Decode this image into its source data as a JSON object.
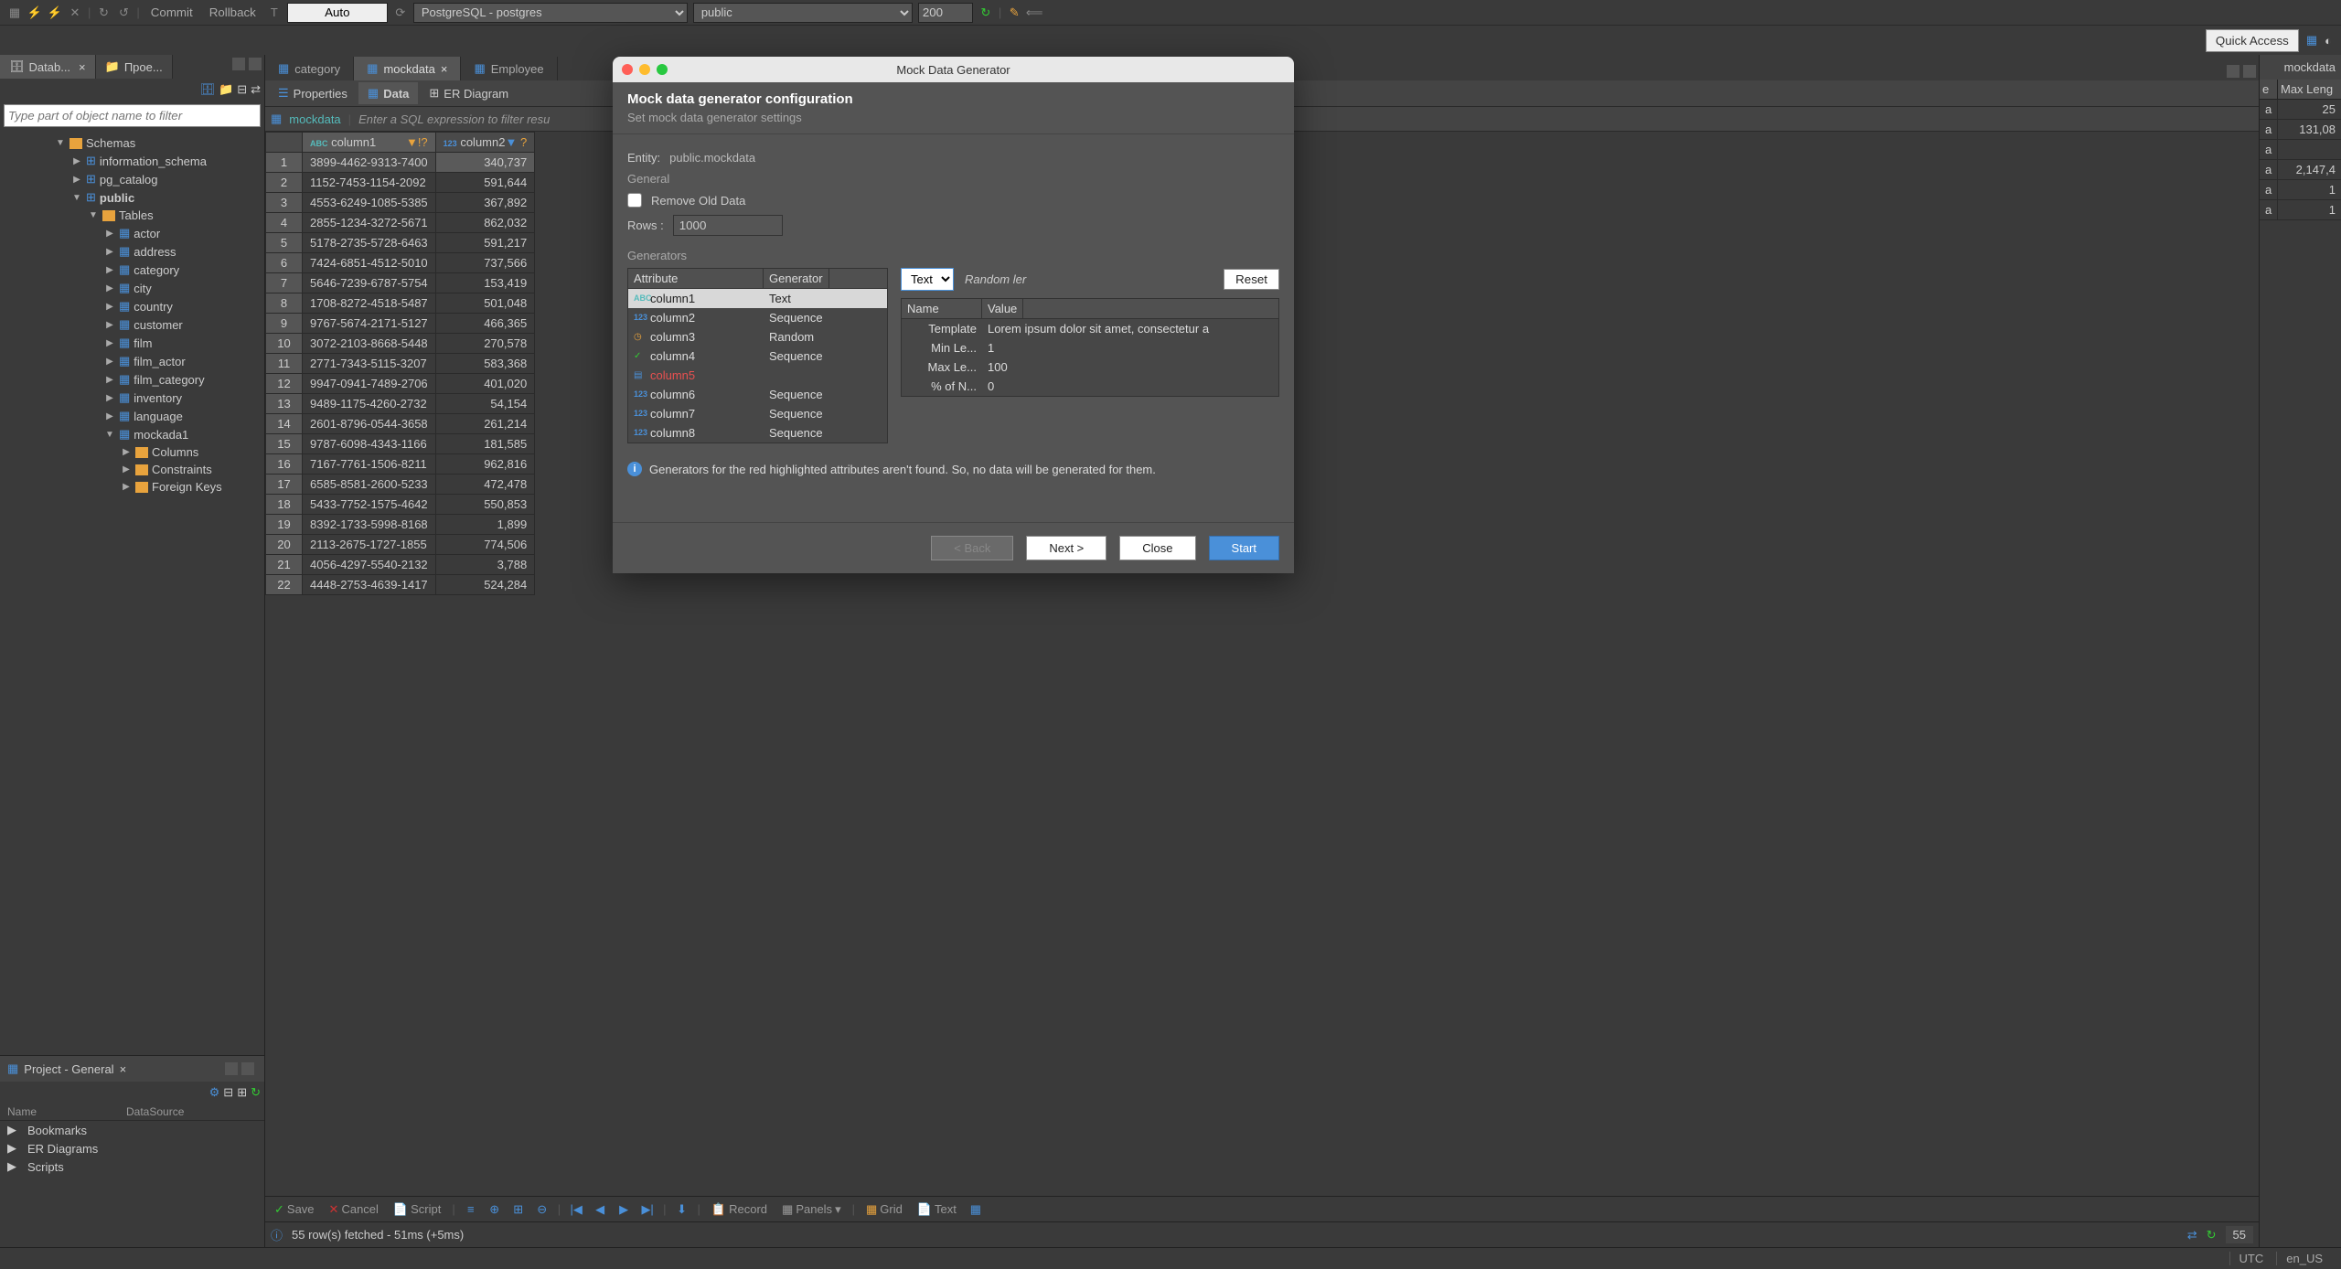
{
  "top_toolbar": {
    "commit": "Commit",
    "rollback": "Rollback",
    "mode": "Auto",
    "connection": "PostgreSQL - postgres",
    "schema": "public",
    "limit": "200"
  },
  "quick_access": "Quick Access",
  "left_tabs": {
    "database": "Datab...",
    "project": "Прое..."
  },
  "filter_placeholder": "Type part of object name to filter",
  "tree": {
    "schemas": "Schemas",
    "info_schema": "information_schema",
    "pg_catalog": "pg_catalog",
    "public": "public",
    "tables": "Tables",
    "items": [
      "actor",
      "address",
      "category",
      "city",
      "country",
      "customer",
      "film",
      "film_actor",
      "film_category",
      "inventory",
      "language",
      "mockada1"
    ],
    "sub": {
      "columns": "Columns",
      "constraints": "Constraints",
      "foreign_keys": "Foreign Keys"
    }
  },
  "project_panel": {
    "title": "Project - General",
    "cols": {
      "name": "Name",
      "datasource": "DataSource"
    },
    "items": [
      "Bookmarks",
      "ER Diagrams",
      "Scripts"
    ]
  },
  "editor_tabs": {
    "category": "category",
    "mockdata": "mockdata",
    "employee": "Employee"
  },
  "sub_tabs": {
    "properties": "Properties",
    "data": "Data",
    "er": "ER Diagram"
  },
  "filter_bar": {
    "table": "mockdata",
    "hint": "Enter a SQL expression to filter resu"
  },
  "columns": {
    "c1": "column1",
    "c2": "column2"
  },
  "rows": [
    {
      "n": 1,
      "c1": "3899-4462-9313-7400",
      "c2": "340,737"
    },
    {
      "n": 2,
      "c1": "1152-7453-1154-2092",
      "c2": "591,644"
    },
    {
      "n": 3,
      "c1": "4553-6249-1085-5385",
      "c2": "367,892"
    },
    {
      "n": 4,
      "c1": "2855-1234-3272-5671",
      "c2": "862,032"
    },
    {
      "n": 5,
      "c1": "5178-2735-5728-6463",
      "c2": "591,217"
    },
    {
      "n": 6,
      "c1": "7424-6851-4512-5010",
      "c2": "737,566"
    },
    {
      "n": 7,
      "c1": "5646-7239-6787-5754",
      "c2": "153,419"
    },
    {
      "n": 8,
      "c1": "1708-8272-4518-5487",
      "c2": "501,048"
    },
    {
      "n": 9,
      "c1": "9767-5674-2171-5127",
      "c2": "466,365"
    },
    {
      "n": 10,
      "c1": "3072-2103-8668-5448",
      "c2": "270,578"
    },
    {
      "n": 11,
      "c1": "2771-7343-5115-3207",
      "c2": "583,368"
    },
    {
      "n": 12,
      "c1": "9947-0941-7489-2706",
      "c2": "401,020"
    },
    {
      "n": 13,
      "c1": "9489-1175-4260-2732",
      "c2": "54,154"
    },
    {
      "n": 14,
      "c1": "2601-8796-0544-3658",
      "c2": "261,214"
    },
    {
      "n": 15,
      "c1": "9787-6098-4343-1166",
      "c2": "181,585"
    },
    {
      "n": 16,
      "c1": "7167-7761-1506-8211",
      "c2": "962,816"
    },
    {
      "n": 17,
      "c1": "6585-8581-2600-5233",
      "c2": "472,478"
    },
    {
      "n": 18,
      "c1": "5433-7752-1575-4642",
      "c2": "550,853"
    },
    {
      "n": 19,
      "c1": "8392-1733-5998-8168",
      "c2": "1,899"
    },
    {
      "n": 20,
      "c1": "2113-2675-1727-1855",
      "c2": "774,506"
    },
    {
      "n": 21,
      "c1": "4056-4297-5540-2132",
      "c2": "3,788"
    },
    {
      "n": 22,
      "c1": "4448-2753-4639-1417",
      "c2": "524,284"
    }
  ],
  "grid_bottom": {
    "save": "Save",
    "cancel": "Cancel",
    "script": "Script",
    "record": "Record",
    "panels": "Panels",
    "grid": "Grid",
    "text": "Text"
  },
  "status": {
    "fetched": "55 row(s) fetched - 51ms (+5ms)",
    "count": "55"
  },
  "right": {
    "title": "mockdata",
    "cols": {
      "e": "e",
      "maxleng": "Max Leng"
    },
    "rows": [
      {
        "e": "a",
        "v": "25"
      },
      {
        "e": "a",
        "v": "131,08"
      },
      {
        "e": "a",
        "v": ""
      },
      {
        "e": "a",
        "v": "2,147,4"
      },
      {
        "e": "a",
        "v": "1"
      },
      {
        "e": "a",
        "v": "1"
      }
    ]
  },
  "footer": {
    "utc": "UTC",
    "locale": "en_US"
  },
  "dialog": {
    "title": "Mock Data Generator",
    "heading": "Mock data generator configuration",
    "subheading": "Set mock data generator settings",
    "entity_label": "Entity:",
    "entity": "public.mockdata",
    "general": "General",
    "remove_old": "Remove Old Data",
    "rows_label": "Rows :",
    "rows_value": "1000",
    "generators": "Generators",
    "th_attr": "Attribute",
    "th_gen": "Generator",
    "gens": [
      {
        "name": "column1",
        "gen": "Text",
        "icon": "abc",
        "sel": true
      },
      {
        "name": "column2",
        "gen": "Sequence",
        "icon": "123"
      },
      {
        "name": "column3",
        "gen": "Random",
        "icon": "clock"
      },
      {
        "name": "column4",
        "gen": "Sequence",
        "icon": "check"
      },
      {
        "name": "column5",
        "gen": "",
        "icon": "file",
        "red": true
      },
      {
        "name": "column6",
        "gen": "Sequence",
        "icon": "123"
      },
      {
        "name": "column7",
        "gen": "Sequence",
        "icon": "123"
      },
      {
        "name": "column8",
        "gen": "Sequence",
        "icon": "123"
      }
    ],
    "gen_type": "Text",
    "gen_label": "Random ler",
    "reset": "Reset",
    "props_th_name": "Name",
    "props_th_value": "Value",
    "props": [
      {
        "n": "Template",
        "v": "Lorem ipsum dolor sit amet, consectetur a"
      },
      {
        "n": "Min Le...",
        "v": "1"
      },
      {
        "n": "Max Le...",
        "v": "100"
      },
      {
        "n": "% of N...",
        "v": "0"
      }
    ],
    "info": "Generators for the red highlighted attributes aren't found. So, no data will be generated for them.",
    "back": "< Back",
    "next": "Next >",
    "close": "Close",
    "start": "Start"
  }
}
